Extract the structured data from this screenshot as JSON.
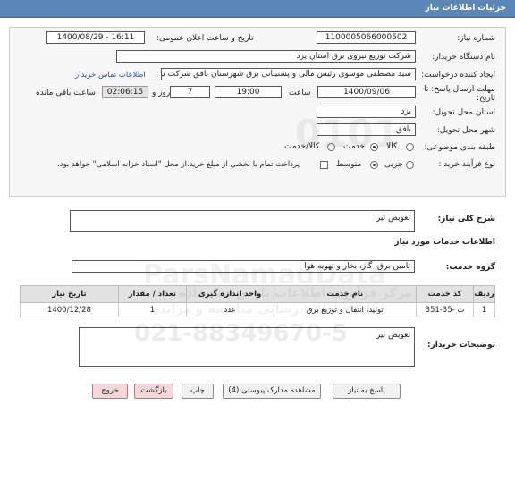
{
  "window": {
    "title": "جزئیات اطلاعات نیاز"
  },
  "form": {
    "need_number_label": "شماره نیاز:",
    "need_number": "1100005066000502",
    "announce_label": "تاریخ و ساعت اعلان عمومی:",
    "announce_value": "1400/08/29 - 16:11",
    "buyer_org_label": "نام دستگاه خریدار:",
    "buyer_org": "شرکت توزیع نیروی برق استان یزد",
    "creator_label": "ایجاد کننده درخواست:",
    "creator": "سید مصطفی  موسوی  رئیس مالی و پشتیبانی برق شهرستان بافق شرکت تو",
    "contact_link": "اطلاعات تماس خریدار",
    "deadline_label": "مهلت ارسال پاسخ: تا تاریخ:",
    "deadline_date": "1400/09/06",
    "time_label": "ساعت",
    "deadline_time": "19:00",
    "days_value": "7",
    "days_label": "روز و",
    "remaining_time": "02:06:15",
    "remaining_label": "ساعت باقی مانده",
    "province_label": "استان محل تحویل:",
    "province": "یزد",
    "city_label": "شهر محل تحویل:",
    "city": "بافق",
    "category_label": "طبقه بندی موضوعی:",
    "category_options": [
      "کالا",
      "خدمت",
      "کالا/خدمت"
    ],
    "category_selected": "خدمت",
    "process_label": "نوع فرآیند خرید :",
    "process_options": [
      "جزیی",
      "متوسط"
    ],
    "process_selected": "متوسط",
    "payment_note": "پرداخت تمام یا بخشی از مبلغ خرید،از محل \"اسناد خزانه اسلامی\" خواهد بود."
  },
  "summary": {
    "label": "شرح کلی نیاز:",
    "value": "تعویض تیر"
  },
  "services": {
    "section_title": "اطلاعات خدمات مورد نیاز",
    "group_label": "گروه خدمت:",
    "group_value": "تامین برق، گاز، بخار و تهویه هوا"
  },
  "table": {
    "headers": [
      "ردیف",
      "کد خدمت",
      "نام خدمت",
      "واحد اندازه گیری",
      "تعداد / مقدار",
      "تاریخ نیاز"
    ],
    "rows": [
      [
        "1",
        "ت -35-351",
        "تولید، انتقال و توزیع برق",
        "عدد",
        "1",
        "1400/12/28"
      ]
    ]
  },
  "buyer_notes": {
    "label": "توضیحات خریدار:",
    "value": "تعویض تیر"
  },
  "buttons": {
    "reply": "پاسخ به نیاز",
    "attachments": "مشاهده مدارک پیوستی (4)",
    "print": "چاپ",
    "back": "بازگشت",
    "exit": "خروج"
  },
  "watermark": {
    "brand": "ParsNamadData",
    "phone": "021-88349670-5",
    "text1": "مرکز فراوری اطلاعات پارس نماد داده",
    "text2": "پایگاه اطلاع رسانی مناقصه و مزایده"
  }
}
